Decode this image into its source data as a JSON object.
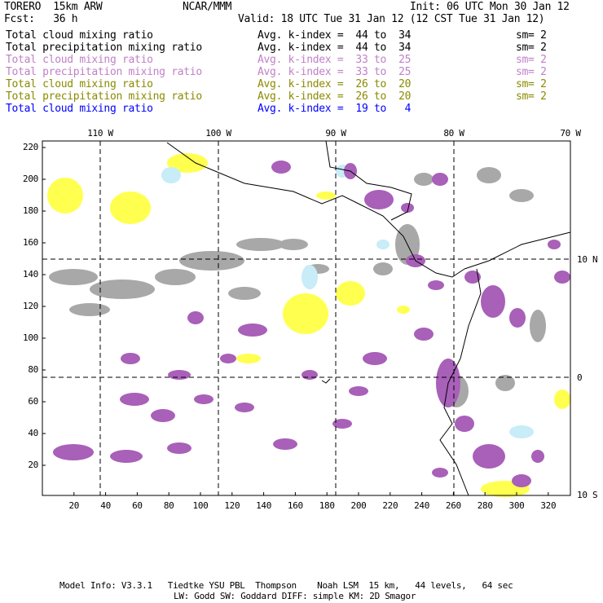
{
  "header": {
    "model": "TORERO  15km ARW",
    "org": "NCAR/MMM",
    "init": "Init: 06 UTC Mon 30 Jan 12",
    "fcst": "Fcst:   36 h",
    "valid": "Valid: 18 UTC Tue 31 Jan 12 (12 CST Tue 31 Jan 12)"
  },
  "legend": [
    {
      "field": "Total cloud mixing ratio",
      "range": "Avg. k-index =  44 to  34",
      "sm": "sm= 2",
      "color": "#000000"
    },
    {
      "field": "Total precipitation mixing ratio",
      "range": "Avg. k-index =  44 to  34",
      "sm": "sm= 2",
      "color": "#000000"
    },
    {
      "field": "Total cloud mixing ratio",
      "range": "Avg. k-index =  33 to  25",
      "sm": "sm= 2",
      "color": "#c080c8"
    },
    {
      "field": "Total precipitation mixing ratio",
      "range": "Avg. k-index =  33 to  25",
      "sm": "sm= 2",
      "color": "#c080c8"
    },
    {
      "field": "Total cloud mixing ratio",
      "range": "Avg. k-index =  26 to  20",
      "sm": "sm= 2",
      "color": "#8a8a00"
    },
    {
      "field": "Total precipitation mixing ratio",
      "range": "Avg. k-index =  26 to  20",
      "sm": "sm= 2",
      "color": "#8a8a00"
    },
    {
      "field": "Total cloud mixing ratio",
      "range": "Avg. k-index =  19 to   4",
      "sm": "",
      "color": "#0000ff"
    }
  ],
  "map": {
    "lon_labels": [
      "110 W",
      "100 W",
      "90 W",
      "80 W",
      "70 W"
    ],
    "lat_labels": [
      "10 N",
      "0",
      "10 S"
    ],
    "x_ticks": [
      "20",
      "40",
      "60",
      "80",
      "100",
      "120",
      "140",
      "160",
      "180",
      "200",
      "220",
      "240",
      "260",
      "280",
      "300",
      "320"
    ],
    "y_ticks": [
      "20",
      "40",
      "60",
      "80",
      "100",
      "120",
      "140",
      "160",
      "180",
      "200",
      "220"
    ],
    "fill_colors": {
      "gray": "#a8a8a8",
      "purple": "#a860b8",
      "yellow": "#ffff50",
      "lightblue": "#c8ecf8"
    }
  },
  "footer": {
    "line1": "Model Info: V3.3.1   Tiedtke YSU PBL  Thompson    Noah LSM  15 km,   44 levels,   64 sec",
    "line2": "LW: Godd SW: Goddard DIFF: simple KM: 2D Smagor"
  }
}
